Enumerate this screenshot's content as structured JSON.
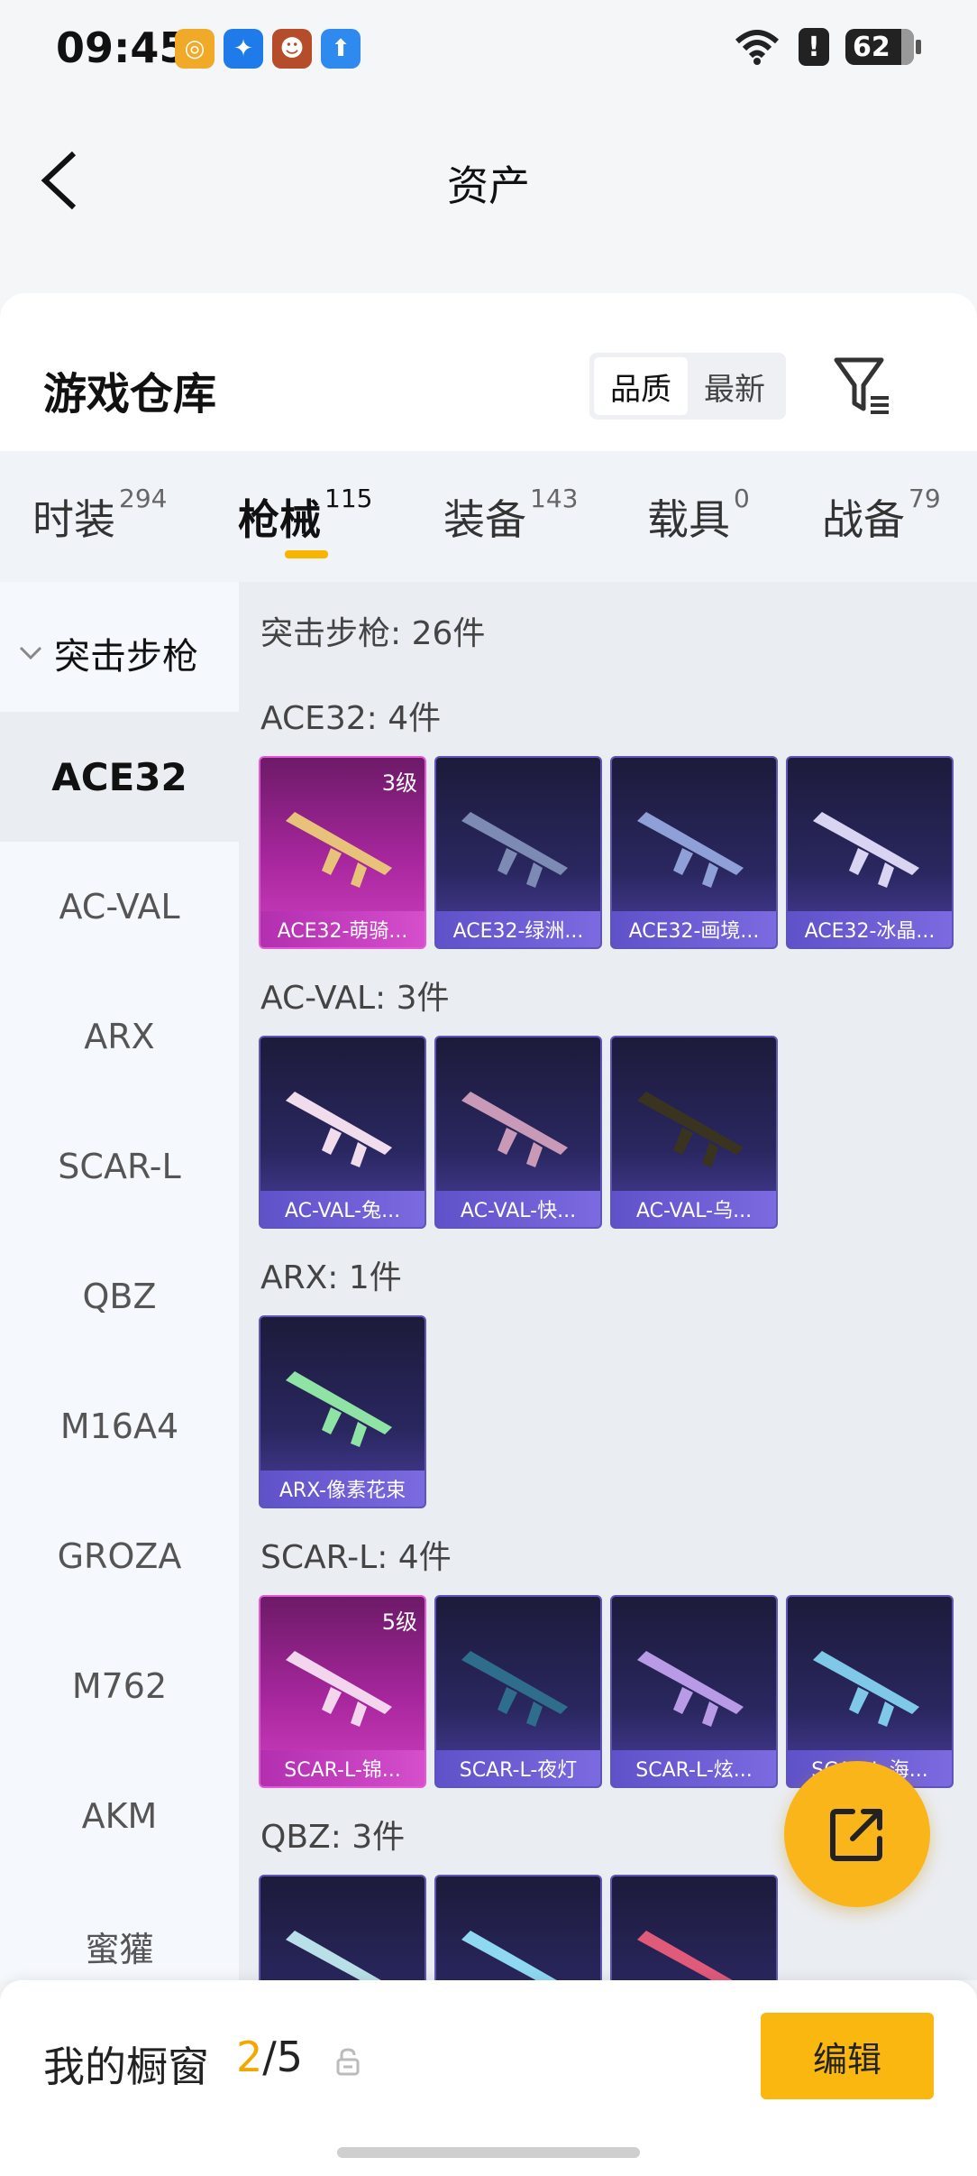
{
  "status_bar": {
    "time": "09:45",
    "battery": "62"
  },
  "header": {
    "title": "资产"
  },
  "warehouse": {
    "title": "游戏仓库",
    "sort_options": [
      "品质",
      "最新"
    ],
    "active_sort": "品质"
  },
  "tabs": [
    {
      "label": "时装",
      "count": "294"
    },
    {
      "label": "枪械",
      "count": "115"
    },
    {
      "label": "装备",
      "count": "143"
    },
    {
      "label": "载具",
      "count": "0"
    },
    {
      "label": "战备",
      "count": "79"
    }
  ],
  "sidebar": {
    "header": "突击步枪",
    "items": [
      "ACE32",
      "AC-VAL",
      "ARX",
      "SCAR-L",
      "QBZ",
      "M16A4",
      "GROZA",
      "M762",
      "AKM",
      "蜜獾"
    ]
  },
  "content": {
    "title": "突击步枪: 26件",
    "groups": [
      {
        "title": "ACE32: 4件",
        "items": [
          {
            "label": "ACE32-萌骑...",
            "level": "3级"
          },
          {
            "label": "ACE32-绿洲..."
          },
          {
            "label": "ACE32-画境..."
          },
          {
            "label": "ACE32-冰晶..."
          }
        ]
      },
      {
        "title": "AC-VAL: 3件",
        "items": [
          {
            "label": "AC-VAL-兔..."
          },
          {
            "label": "AC-VAL-快..."
          },
          {
            "label": "AC-VAL-乌..."
          }
        ]
      },
      {
        "title": "ARX: 1件",
        "items": [
          {
            "label": "ARX-像素花束"
          }
        ]
      },
      {
        "title": "SCAR-L: 4件",
        "items": [
          {
            "label": "SCAR-L-锦...",
            "level": "5级"
          },
          {
            "label": "SCAR-L-夜灯"
          },
          {
            "label": "SCAR-L-炫..."
          },
          {
            "label": "SCAR-L-海..."
          }
        ]
      },
      {
        "title": "QBZ: 3件",
        "items": [
          {
            "label": ""
          },
          {
            "label": ""
          },
          {
            "label": ""
          }
        ]
      }
    ]
  },
  "bottom": {
    "showcase_label": "我的橱窗",
    "showcase_current": "2",
    "showcase_total": "/5",
    "edit_label": "编辑"
  },
  "colors": {
    "accent": "#f9b519",
    "card_blue": "#2a2760",
    "card_pink": "#a8279e"
  }
}
